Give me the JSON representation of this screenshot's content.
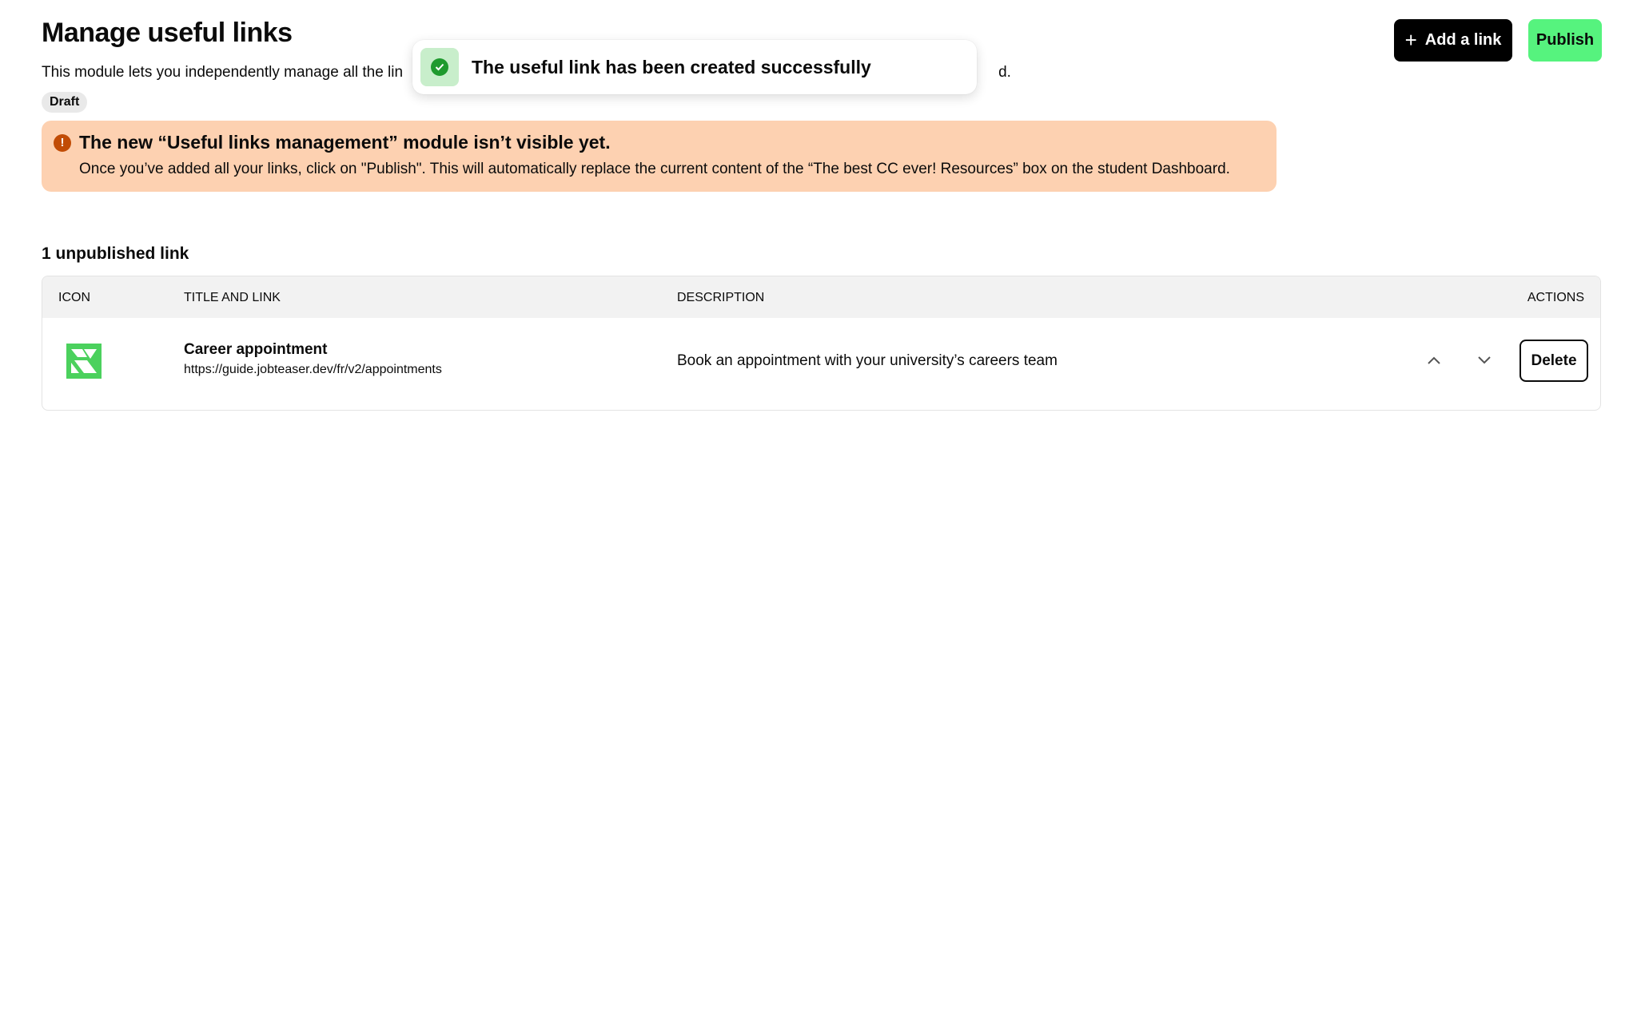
{
  "header": {
    "title": "Manage useful links",
    "description": "This module lets you independently manage all the lin",
    "description_end": "d.",
    "status": "Draft"
  },
  "toolbar": {
    "add_icon": "plus-icon",
    "add_label": "Add a link",
    "publish_label": "Publish",
    "accent_color": "#56f37e"
  },
  "toast": {
    "message": "The useful link has been created successfully",
    "icon": "check-circle-icon",
    "color": "#1f9a2e"
  },
  "alert": {
    "icon": "alert-circle-icon",
    "icon_glyph": "!",
    "title": "The new “Useful links management” module isn’t visible yet.",
    "body": "Once you’ve added all your links, click on \"Publish\". This will automatically replace the current content of the “The best CC ever! Resources” box on the student Dashboard.",
    "background": "#fdd1b1"
  },
  "links_section": {
    "title": "1 unpublished link",
    "columns": {
      "icon": "ICON",
      "title": "TITLE AND LINK",
      "description": "DESCRIPTION",
      "actions": "ACTIONS"
    },
    "rows": [
      {
        "icon": "jobteaser-logo",
        "title": "Career appointment",
        "url": "https://guide.jobteaser.dev/fr/v2/appointments",
        "description": "Book an appointment with your university’s careers team",
        "delete_label": "Delete"
      }
    ]
  }
}
